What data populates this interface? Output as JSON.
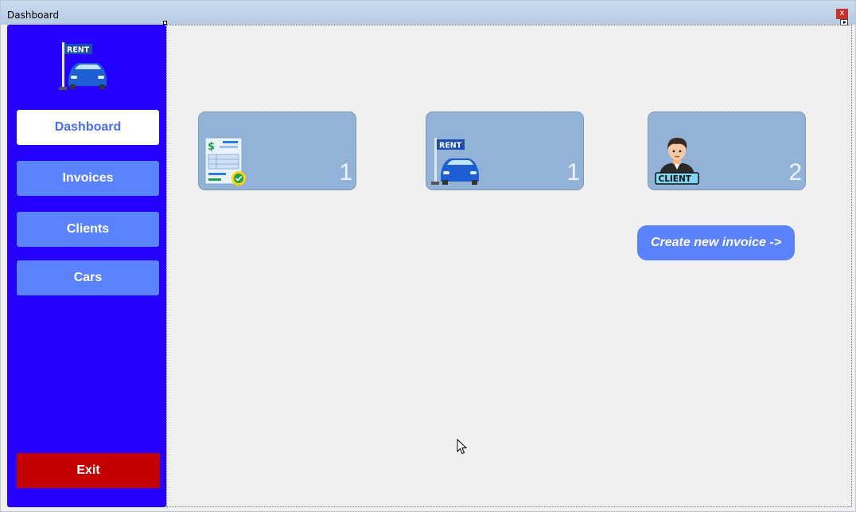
{
  "window": {
    "title": "Dashboard",
    "close_label": "x"
  },
  "sidebar": {
    "logo_text": "RENT",
    "items": [
      {
        "label": "Dashboard",
        "active": true
      },
      {
        "label": "Invoices"
      },
      {
        "label": "Clients"
      },
      {
        "label": "Cars"
      }
    ],
    "exit_label": "Exit"
  },
  "cards": [
    {
      "icon": "invoice-icon",
      "count": "1"
    },
    {
      "icon": "rent-car-icon",
      "icon_text": "RENT",
      "count": "1"
    },
    {
      "icon": "client-icon",
      "icon_text": "CLIENT",
      "count": "2"
    }
  ],
  "actions": {
    "create_invoice_label": "Create new invoice ->"
  },
  "colors": {
    "sidebar_bg": "#2500ff",
    "nav_button": "#5b82ff",
    "exit_button": "#c40000",
    "card_bg": "#93b2d8"
  }
}
